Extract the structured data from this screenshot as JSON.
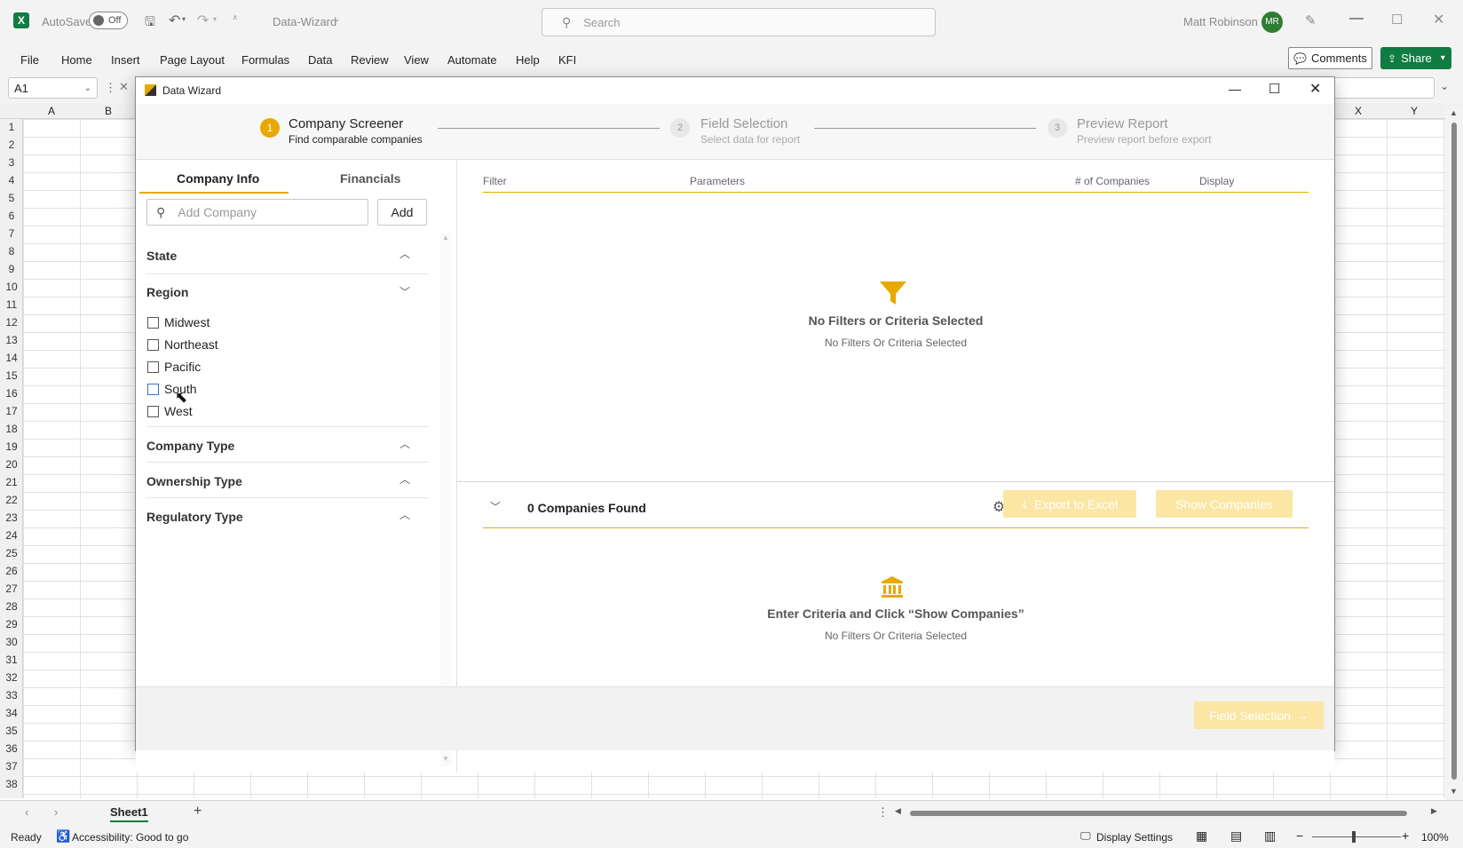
{
  "titlebar": {
    "autosave_label": "AutoSave",
    "autosave_state": "Off",
    "doc_name": "Data-Wizard",
    "search_placeholder": "Search",
    "user_name": "Matt Robinson",
    "user_initials": "MR"
  },
  "ribbon": {
    "tabs": [
      "File",
      "Home",
      "Insert",
      "Page Layout",
      "Formulas",
      "Data",
      "Review",
      "View",
      "Automate",
      "Help",
      "KFI"
    ],
    "comments_label": "Comments",
    "share_label": "Share"
  },
  "formula_bar": {
    "name_box": "A1"
  },
  "sheet": {
    "col_left": [
      "A",
      "B"
    ],
    "col_right": [
      "X",
      "Y"
    ],
    "rows": [
      "1",
      "2",
      "3",
      "4",
      "5",
      "6",
      "7",
      "8",
      "9",
      "10",
      "11",
      "12",
      "13",
      "14",
      "15",
      "16",
      "17",
      "18",
      "19",
      "20",
      "21",
      "22",
      "23",
      "24",
      "25",
      "26",
      "27",
      "28",
      "29",
      "30",
      "31",
      "32",
      "33",
      "34",
      "35",
      "36",
      "37",
      "38"
    ],
    "tab_name": "Sheet1"
  },
  "dialog": {
    "title": "Data Wizard",
    "steps": [
      {
        "num": "1",
        "title": "Company Screener",
        "subtitle": "Find comparable companies"
      },
      {
        "num": "2",
        "title": "Field Selection",
        "subtitle": "Select data for report"
      },
      {
        "num": "3",
        "title": "Preview Report",
        "subtitle": "Preview report before export"
      }
    ],
    "tabs": {
      "company_info": "Company Info",
      "financials": "Financials"
    },
    "add_company_placeholder": "Add Company",
    "add_button": "Add",
    "sections": {
      "state": "State",
      "region": "Region",
      "company_type": "Company Type",
      "ownership_type": "Ownership Type",
      "regulatory_type": "Regulatory Type"
    },
    "regions": [
      "Midwest",
      "Northeast",
      "Pacific",
      "South",
      "West"
    ],
    "table_headers": {
      "filter": "Filter",
      "parameters": "Parameters",
      "companies": "# of Companies",
      "display": "Display"
    },
    "empty_title": "No Filters or Criteria Selected",
    "empty_sub": "No Filters Or Criteria Selected",
    "found_label": "0 Companies Found",
    "export_button": "Export to Excel",
    "show_button": "Show Companies",
    "results_title": "Enter Criteria and Click “Show Companies”",
    "results_sub": "No Filters Or Criteria Selected",
    "next_button": "Field Selection"
  },
  "status": {
    "ready": "Ready",
    "accessibility": "Accessibility: Good to go",
    "display_settings": "Display Settings",
    "zoom": "100%"
  },
  "colors": {
    "accent": "#e7a800",
    "excel_green": "#107c41"
  }
}
